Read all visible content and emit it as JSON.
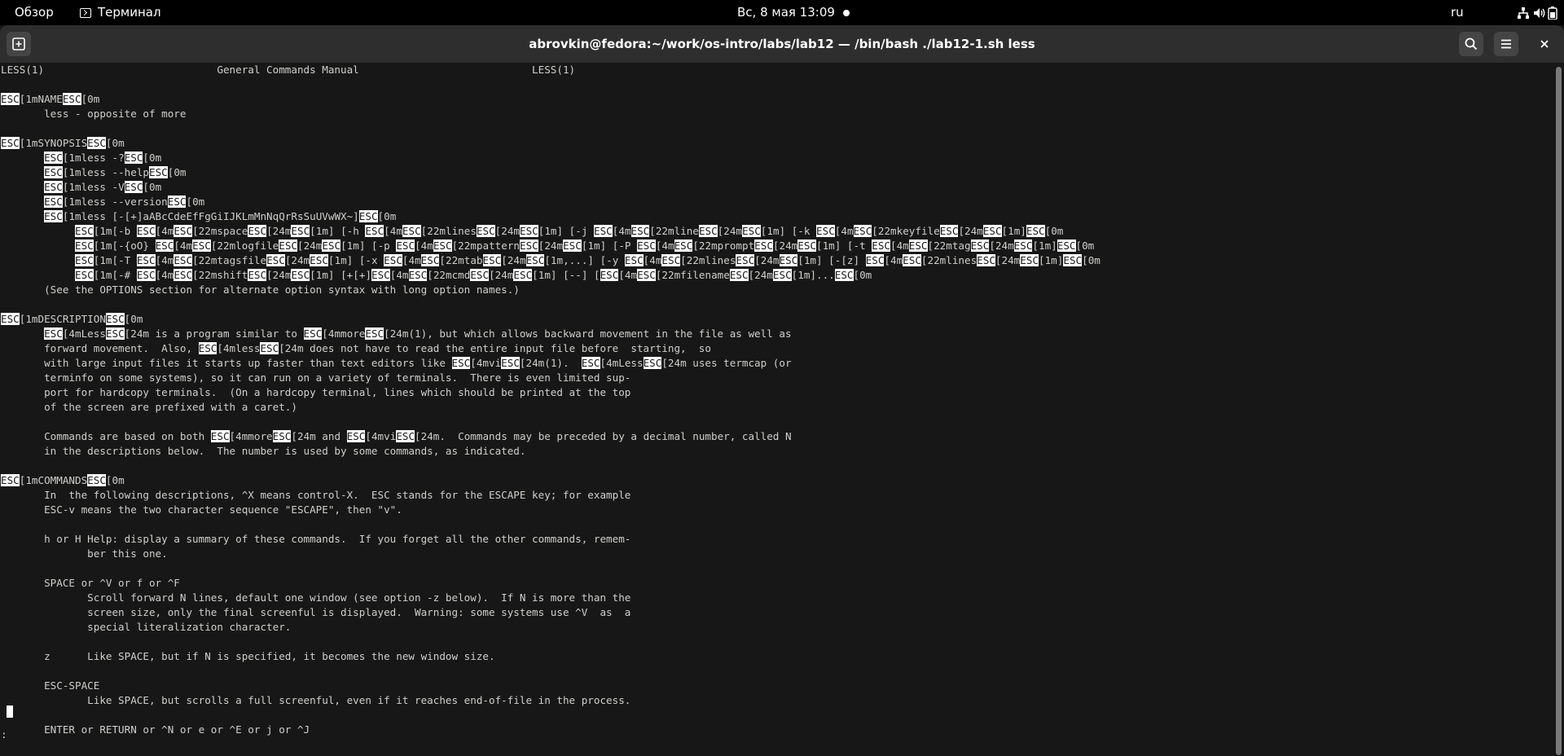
{
  "topbar": {
    "activities": "Обзор",
    "app_name": "Терминал",
    "clock": "Вс, 8 мая  13:09",
    "lang": "ru",
    "tray_icons": [
      "network-icon",
      "volume-icon",
      "battery-icon"
    ]
  },
  "window": {
    "title": "abrovkin@fedora:~/work/os-intro/labs/lab12 — /bin/bash ./lab12-1.sh less"
  },
  "colors": {
    "terminal_bg": "#171717",
    "terminal_fg": "#d0cfcc",
    "headerbar_bg": "#2e2e2e",
    "esc_highlight": "#ffffff"
  },
  "terminal": {
    "prompt": ":",
    "lines": [
      "LESS(1)                            General Commands Manual                            LESS(1)",
      "",
      "{ESC}[1mNAME{ESC}[0m",
      "       less - opposite of more",
      "",
      "{ESC}[1mSYNOPSIS{ESC}[0m",
      "       {ESC}[1mless -?{ESC}[0m",
      "       {ESC}[1mless --help{ESC}[0m",
      "       {ESC}[1mless -V{ESC}[0m",
      "       {ESC}[1mless --version{ESC}[0m",
      "       {ESC}[1mless [-[+]aABcCdeEfFgGiIJKLmMnNqQrRsSuUVwWX~]{ESC}[0m",
      "            {ESC}[1m[-b {ESC}[4m{ESC}[22mspace{ESC}[24m{ESC}[1m] [-h {ESC}[4m{ESC}[22mlines{ESC}[24m{ESC}[1m] [-j {ESC}[4m{ESC}[22mline{ESC}[24m{ESC}[1m] [-k {ESC}[4m{ESC}[22mkeyfile{ESC}[24m{ESC}[1m]{ESC}[0m",
      "            {ESC}[1m[-{oO} {ESC}[4m{ESC}[22mlogfile{ESC}[24m{ESC}[1m] [-p {ESC}[4m{ESC}[22mpattern{ESC}[24m{ESC}[1m] [-P {ESC}[4m{ESC}[22mprompt{ESC}[24m{ESC}[1m] [-t {ESC}[4m{ESC}[22mtag{ESC}[24m{ESC}[1m]{ESC}[0m",
      "            {ESC}[1m[-T {ESC}[4m{ESC}[22mtagsfile{ESC}[24m{ESC}[1m] [-x {ESC}[4m{ESC}[22mtab{ESC}[24m{ESC}[1m,...] [-y {ESC}[4m{ESC}[22mlines{ESC}[24m{ESC}[1m] [-[z] {ESC}[4m{ESC}[22mlines{ESC}[24m{ESC}[1m]{ESC}[0m",
      "            {ESC}[1m[-# {ESC}[4m{ESC}[22mshift{ESC}[24m{ESC}[1m] [+[+]{ESC}[4m{ESC}[22mcmd{ESC}[24m{ESC}[1m] [--] [{ESC}[4m{ESC}[22mfilename{ESC}[24m{ESC}[1m]...{ESC}[0m",
      "       (See the OPTIONS section for alternate option syntax with long option names.)",
      "",
      "{ESC}[1mDESCRIPTION{ESC}[0m",
      "       {ESC}[4mLess{ESC}[24m is a program similar to {ESC}[4mmore{ESC}[24m(1), but which allows backward movement in the file as well as",
      "       forward movement.  Also, {ESC}[4mless{ESC}[24m does not have to read the entire input file before  starting,  so",
      "       with large input files it starts up faster than text editors like {ESC}[4mvi{ESC}[24m(1).  {ESC}[4mLess{ESC}[24m uses termcap (or",
      "       terminfo on some systems), so it can run on a variety of terminals.  There is even limited sup-",
      "       port for hardcopy terminals.  (On a hardcopy terminal, lines which should be printed at the top",
      "       of the screen are prefixed with a caret.)",
      "",
      "       Commands are based on both {ESC}[4mmore{ESC}[24m and {ESC}[4mvi{ESC}[24m.  Commands may be preceded by a decimal number, called N",
      "       in the descriptions below.  The number is used by some commands, as indicated.",
      "",
      "{ESC}[1mCOMMANDS{ESC}[0m",
      "       In  the following descriptions, ^X means control-X.  ESC stands for the ESCAPE key; for example",
      "       ESC-v means the two character sequence \"ESCAPE\", then \"v\".",
      "",
      "       h or H Help: display a summary of these commands.  If you forget all the other commands, remem-",
      "              ber this one.",
      "",
      "       SPACE or ^V or f or ^F",
      "              Scroll forward N lines, default one window (see option -z below).  If N is more than the",
      "              screen size, only the final screenful is displayed.  Warning: some systems use ^V  as  a",
      "              special literalization character.",
      "",
      "       z      Like SPACE, but if N is specified, it becomes the new window size.",
      "",
      "       ESC-SPACE",
      "              Like SPACE, but scrolls a full screenful, even if it reaches end-of-file in the process.",
      "",
      "       ENTER or RETURN or ^N or e or ^E or j or ^J"
    ]
  }
}
